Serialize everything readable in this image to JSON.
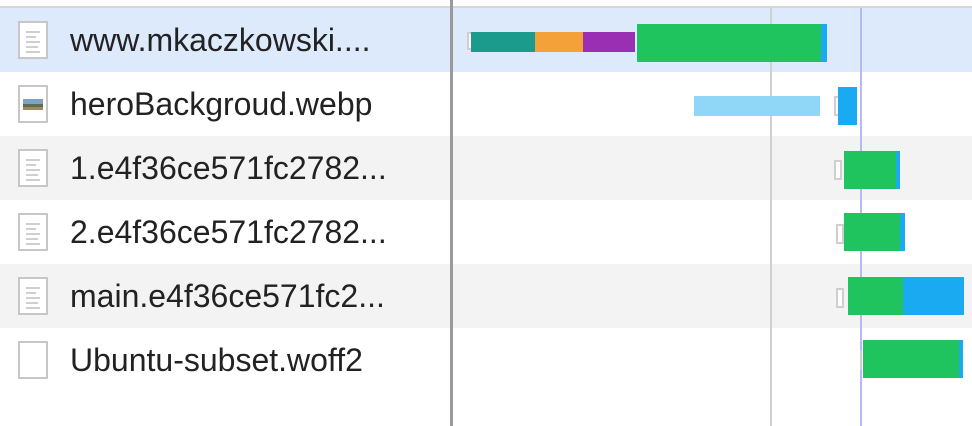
{
  "colors": {
    "stalled": "#1a9b8c",
    "dns": "#f5a13a",
    "ssl": "#9b2fb3",
    "waiting": "#1fc45e",
    "download": "#19aaf2",
    "queued": "#8fd6f7",
    "dom_content_loaded_marker": "#d0d0d0",
    "load_marker": "#b8b8f2",
    "selected_row": "#ddeafc",
    "striped_row": "#f3f3f3"
  },
  "requests": [
    {
      "name": "www.mkaczkowski....",
      "icon": "document-icon",
      "selected": true
    },
    {
      "name": "heroBackgroud.webp",
      "icon": "image-icon",
      "selected": false
    },
    {
      "name": "1.e4f36ce571fc2782...",
      "icon": "script-icon",
      "selected": false
    },
    {
      "name": "2.e4f36ce571fc2782...",
      "icon": "script-icon",
      "selected": false
    },
    {
      "name": "main.e4f36ce571fc2...",
      "icon": "script-icon",
      "selected": false
    },
    {
      "name": "Ubuntu-subset.woff2",
      "icon": "font-icon",
      "selected": false
    }
  ]
}
